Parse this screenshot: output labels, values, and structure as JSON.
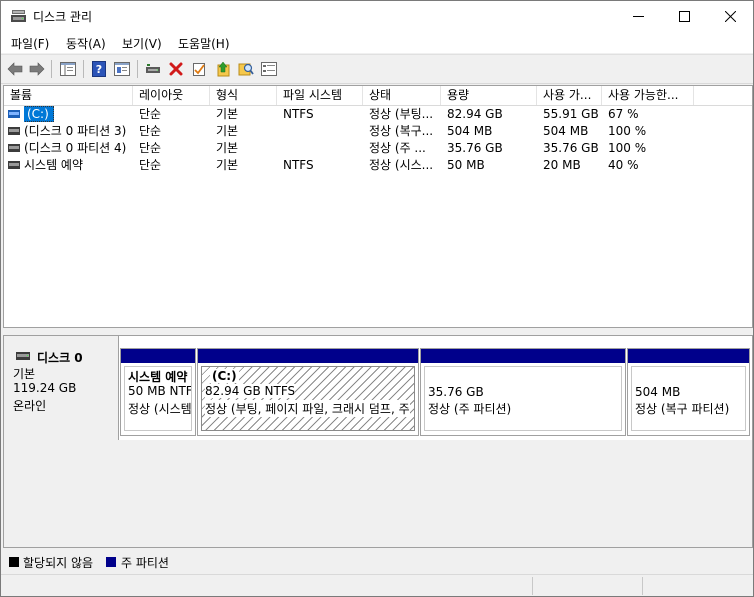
{
  "window": {
    "title": "디스크 관리"
  },
  "menu": [
    {
      "label": "파일(F)"
    },
    {
      "label": "동작(A)"
    },
    {
      "label": "보기(V)"
    },
    {
      "label": "도움말(H)"
    }
  ],
  "toolbar": {
    "icons": [
      "back-arrow-icon",
      "forward-arrow-icon",
      "console-tree-icon",
      "help-icon",
      "help-topics-icon",
      "rescan-disks-icon",
      "delete-icon",
      "properties-check-icon",
      "up-folder-icon",
      "search-folder-icon",
      "disk-list-icon"
    ]
  },
  "volume_list": {
    "columns": [
      "볼륨",
      "레이아웃",
      "형식",
      "파일 시스템",
      "상태",
      "용량",
      "사용 가...",
      "사용 가능한..."
    ],
    "rows": [
      {
        "volume": "(C:)",
        "layout": "단순",
        "type": "기본",
        "fs": "NTFS",
        "status": "정상 (부팅...",
        "capacity": "82.94 GB",
        "free": "55.91 GB",
        "pct": "67 %",
        "selected": true
      },
      {
        "volume": "(디스크 0 파티션 3)",
        "layout": "단순",
        "type": "기본",
        "fs": "",
        "status": "정상 (복구...",
        "capacity": "504 MB",
        "free": "504 MB",
        "pct": "100 %"
      },
      {
        "volume": "(디스크 0 파티션 4)",
        "layout": "단순",
        "type": "기본",
        "fs": "",
        "status": "정상 (주 ...",
        "capacity": "35.76 GB",
        "free": "35.76 GB",
        "pct": "100 %"
      },
      {
        "volume": "시스템 예약",
        "layout": "단순",
        "type": "기본",
        "fs": "NTFS",
        "status": "정상 (시스...",
        "capacity": "50 MB",
        "free": "20 MB",
        "pct": "40 %"
      }
    ]
  },
  "disk": {
    "name": "디스크 0",
    "type": "기본",
    "size": "119.24 GB",
    "state": "온라인",
    "partitions": [
      {
        "name": "시스템 예약",
        "size": "50 MB NTFS",
        "status": "정상 (시스템"
      },
      {
        "name": "(C:)",
        "size": "82.94 GB NTFS",
        "status": "정상 (부팅, 페이지 파일, 크래시 덤프, 주"
      },
      {
        "name": "",
        "size": "35.76 GB",
        "status": "정상 (주 파티션)"
      },
      {
        "name": "",
        "size": "504 MB",
        "status": "정상 (복구 파티션)"
      }
    ]
  },
  "legend": [
    {
      "label": "할당되지 않음",
      "color": "#000000"
    },
    {
      "label": "주 파티션",
      "color": "#00008b"
    }
  ],
  "colors": {
    "accent": "#0078d7",
    "primary_partition": "#00008b"
  }
}
